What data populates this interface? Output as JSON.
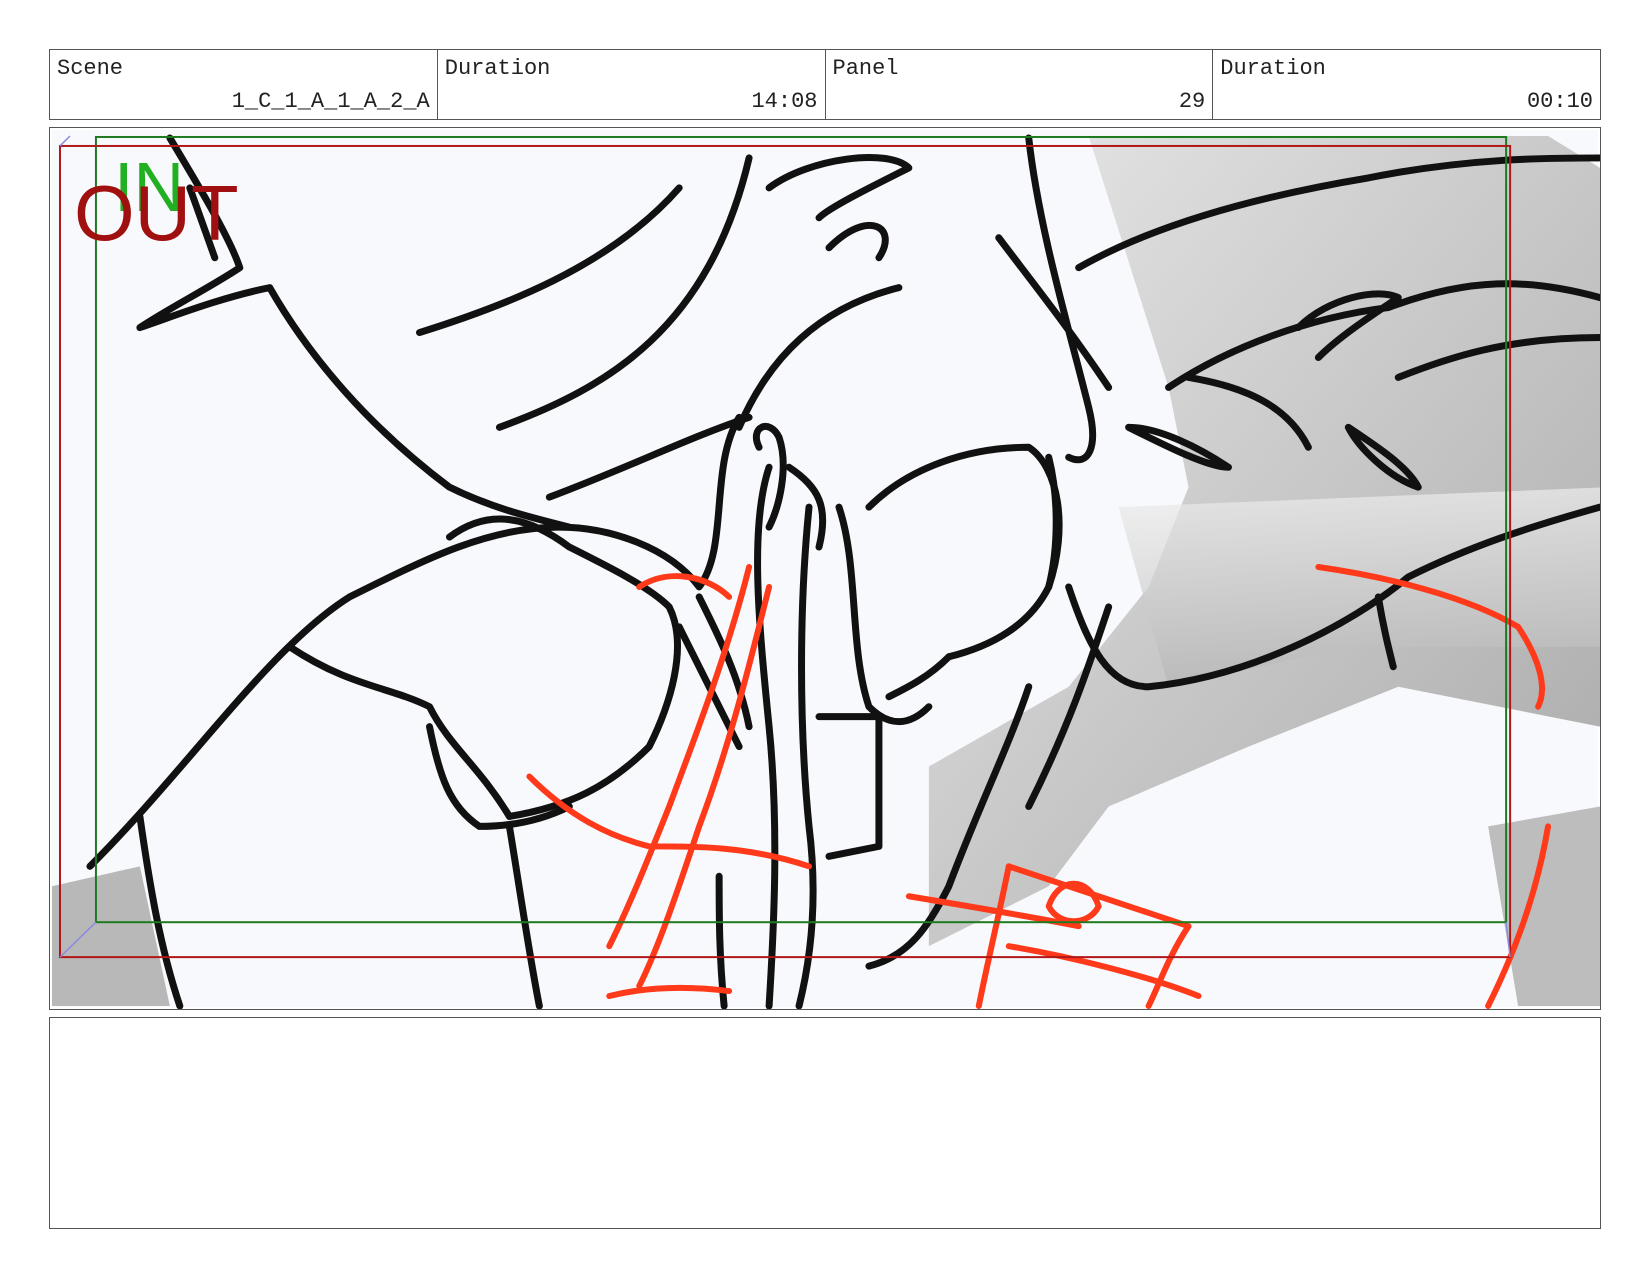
{
  "header": {
    "scene_label": "Scene",
    "scene_value": "1_C_1_A_1_A_2_A",
    "duration_label": "Duration",
    "duration_value": "14:08",
    "panel_label": "Panel",
    "panel_value": "29",
    "panel_duration_label": "Duration",
    "panel_duration_value": "00:10"
  },
  "frame": {
    "in_label": "IN",
    "out_label": "OUT",
    "in_color": "#22b022",
    "out_color": "#a01010",
    "sketch_stroke_color": "#111111",
    "sketch_accent_color": "#ff3a1a",
    "background_shading": "#c8c8c8"
  },
  "notes": {
    "text": ""
  }
}
